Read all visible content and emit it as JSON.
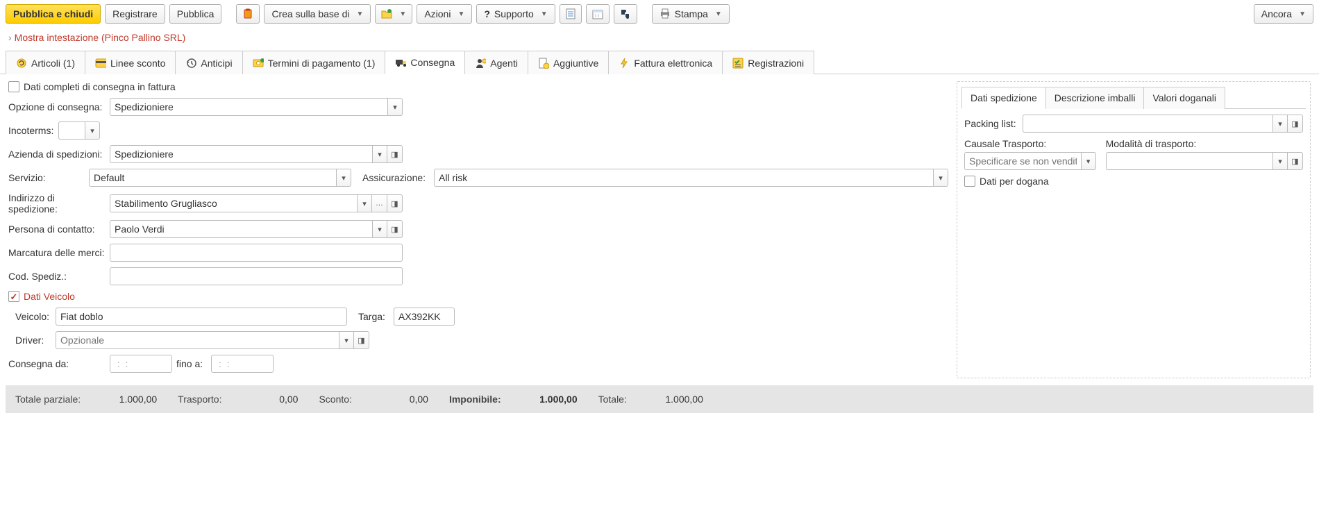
{
  "toolbar": {
    "publish_close": "Pubblica e chiudi",
    "register": "Registrare",
    "publish": "Pubblica",
    "create_based_on": "Crea sulla base di",
    "actions": "Azioni",
    "support": "Supporto",
    "print": "Stampa",
    "more": "Ancora"
  },
  "header_link": "Mostra intestazione (Pinco Pallino SRL)",
  "tabs": [
    {
      "label": "Articoli (1)"
    },
    {
      "label": "Linee sconto"
    },
    {
      "label": "Anticipi"
    },
    {
      "label": "Termini di pagamento (1)"
    },
    {
      "label": "Consegna"
    },
    {
      "label": "Agenti"
    },
    {
      "label": "Aggiuntive"
    },
    {
      "label": "Fattura elettronica"
    },
    {
      "label": "Registrazioni"
    }
  ],
  "form": {
    "full_delivery_label": "Dati completi di consegna in fattura",
    "delivery_option_label": "Opzione di consegna:",
    "delivery_option_value": "Spedizioniere",
    "incoterms_label": "Incoterms:",
    "incoterms_value": "",
    "shipping_company_label": "Azienda di spedizioni:",
    "shipping_company_value": "Spedizioniere",
    "service_label": "Servizio:",
    "service_value": "Default",
    "insurance_label": "Assicurazione:",
    "insurance_value": "All risk",
    "shipping_address_label": "Indirizzo di spedizione:",
    "shipping_address_value": "Stabilimento Grugliasco",
    "contact_person_label": "Persona di contatto:",
    "contact_person_value": "Paolo Verdi",
    "goods_marking_label": "Marcatura delle merci:",
    "goods_marking_value": "",
    "ship_code_label": "Cod. Spediz.:",
    "ship_code_value": "",
    "vehicle_section": "Dati Veicolo",
    "vehicle_label": "Veicolo:",
    "vehicle_value": "Fiat doblo",
    "plate_label": "Targa:",
    "plate_value": "AX392KK",
    "driver_label": "Driver:",
    "driver_placeholder": "Opzionale",
    "driver_value": "",
    "delivery_from_label": "Consegna da:",
    "delivery_from_value": " :  : ",
    "delivery_to_label": "fino a:",
    "delivery_to_value": " :  : "
  },
  "right": {
    "tab1": "Dati spedizione",
    "tab2": "Descrizione imballi",
    "tab3": "Valori doganali",
    "packing_list_label": "Packing list:",
    "packing_list_value": "",
    "transport_reason_label": "Causale Trasporto:",
    "transport_reason_placeholder": "Specificare se non vendita",
    "transport_mode_label": "Modalità di trasporto:",
    "customs_data_label": "Dati per dogana"
  },
  "footer": {
    "subtotal_label": "Totale parziale:",
    "subtotal_value": "1.000,00",
    "transport_label": "Trasporto:",
    "transport_value": "0,00",
    "discount_label": "Sconto:",
    "discount_value": "0,00",
    "taxable_label": "Imponibile:",
    "taxable_value": "1.000,00",
    "total_label": "Totale:",
    "total_value": "1.000,00"
  }
}
